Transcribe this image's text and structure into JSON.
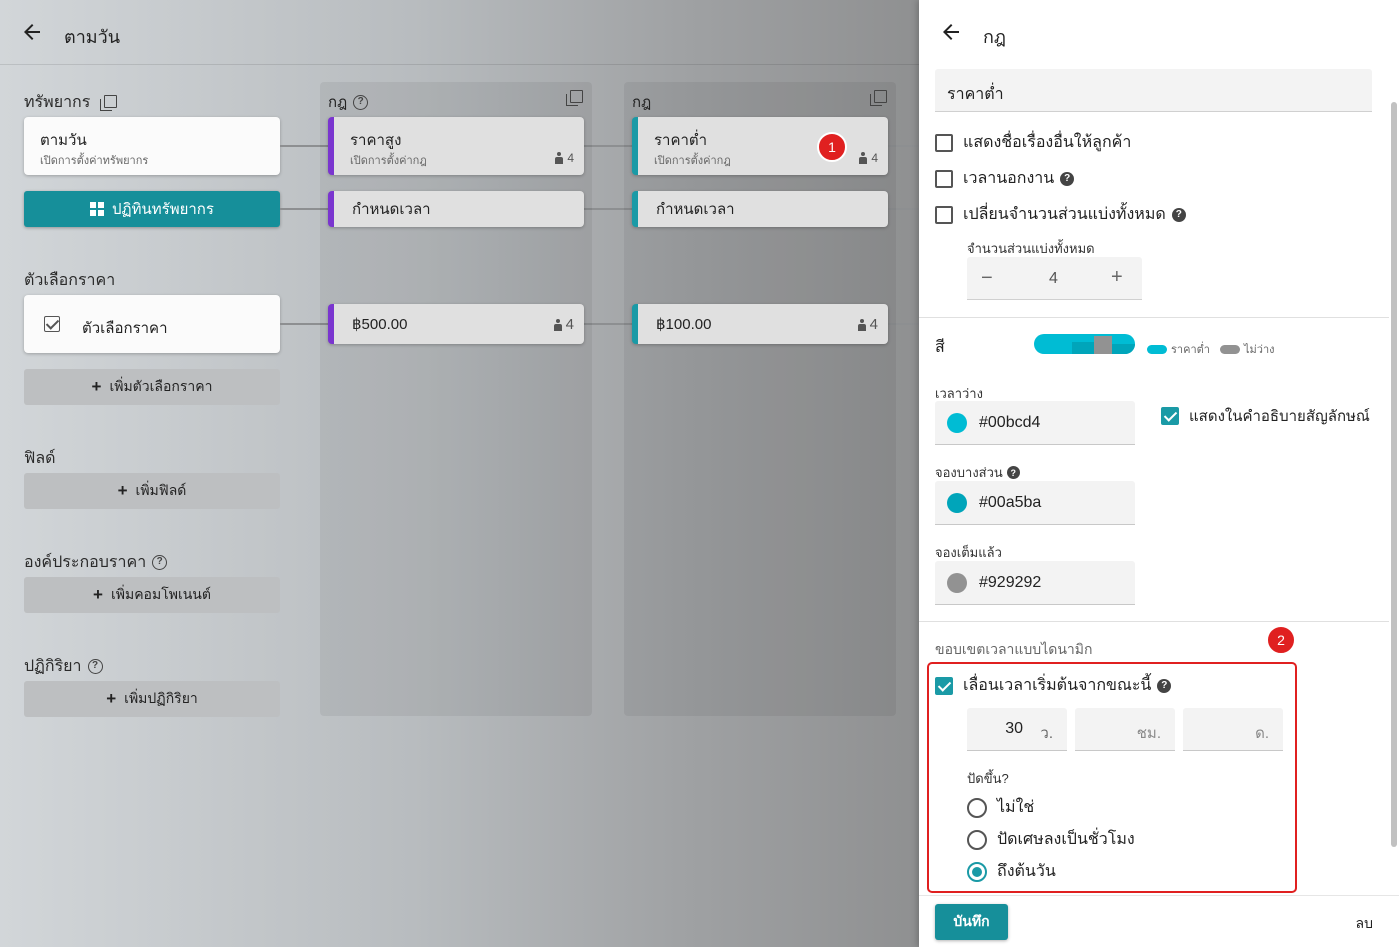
{
  "left": {
    "title": "ตามวัน",
    "resources": {
      "label": "ทรัพยากร",
      "card_title": "ตามวัน",
      "card_subtitle": "เปิดการตั้งค่าทรัพยากร",
      "calendar_button": "ปฏิทินทรัพยากร"
    },
    "price_options": {
      "label": "ตัวเลือกราคา",
      "card_label": "ตัวเลือกราคา",
      "add_button": "เพิ่มตัวเลือกราคา"
    },
    "fields": {
      "label": "ฟิลด์",
      "add_button": "เพิ่มฟิลด์"
    },
    "price_components": {
      "label": "องค์ประกอบราคา",
      "add_button": "เพิ่มคอมโพเนนต์"
    },
    "reactions": {
      "label": "ปฏิกิริยา",
      "add_button": "เพิ่มปฏิกิริยา"
    },
    "rule_columns": [
      {
        "header": "กฎ",
        "rule_title": "ราคาสูง",
        "rule_subtitle": "เปิดการตั้งค่ากฎ",
        "rule_count": "4",
        "time_card": "กำหนดเวลา",
        "price": "฿500.00",
        "price_count": "4"
      },
      {
        "header": "กฎ",
        "rule_title": "ราคาต่ำ",
        "rule_subtitle": "เปิดการตั้งค่ากฎ",
        "rule_count": "4",
        "time_card": "กำหนดเวลา",
        "price": "฿100.00",
        "price_count": "4"
      }
    ],
    "badge_1": "1"
  },
  "panel": {
    "title": "กฎ",
    "name_value": "ราคาต่ำ",
    "show_other_title": "แสดงชื่อเรื่องอื่นให้ลูกค้า",
    "off_hours": "เวลานอกงาน",
    "change_total_shares": "เปลี่ยนจำนวนส่วนแบ่งทั้งหมด",
    "total_shares_label": "จำนวนส่วนแบ่งทั้งหมด",
    "total_shares_value": "4",
    "minus": "−",
    "plus": "+",
    "color_label": "สี",
    "legend_low_price": "ราคาต่ำ",
    "legend_unavailable": "ไม่ว่าง",
    "available_label": "เวลาว่าง",
    "available_color": "#00bcd4",
    "show_in_legend": "แสดงในคำอธิบายสัญลักษณ์",
    "partial_label": "จองบางส่วน",
    "partial_color": "#00a5ba",
    "full_label": "จองเต็มแล้ว",
    "full_color": "#929292",
    "dynamic_section": "ขอบเขตเวลาแบบไดนามิก",
    "shift_start_now": "เลื่อนเวลาเริ่มต้นจากขณะนี้",
    "seconds_value": "30",
    "seconds_unit": "ว.",
    "hours_unit": "ชม.",
    "days_unit": "ด.",
    "round_up_label": "ปัดขึ้น?",
    "radio_no": "ไม่ใช่",
    "radio_hour": "ปัดเศษลงเป็นชั่วโมง",
    "radio_day": "ถึงต้นวัน",
    "save_button": "บันทึก",
    "delete_button": "ลบ",
    "badge_2": "2"
  },
  "colors": {
    "accent_teal": "#1a9aa6",
    "accent_purple": "#7a35cf",
    "highlight_red": "#e02020"
  }
}
